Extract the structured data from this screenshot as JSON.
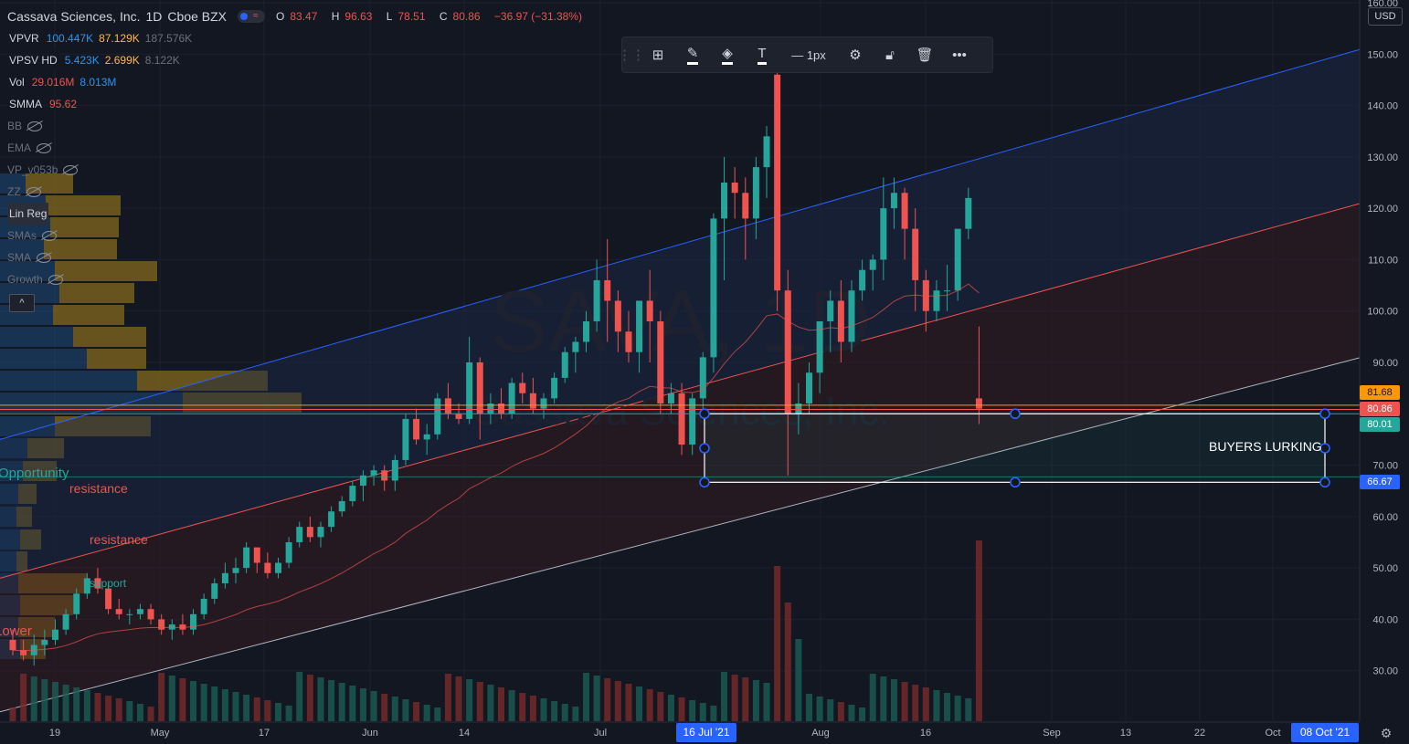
{
  "header": {
    "symbol_name": "Cassava Sciences, Inc.",
    "interval": "1D",
    "exchange": "Cboe BZX",
    "ohlc": {
      "o_label": "O",
      "o": "83.47",
      "h_label": "H",
      "h": "96.63",
      "l_label": "L",
      "l": "78.51",
      "c_label": "C",
      "c": "80.86",
      "change": "−36.97 (−31.38%)"
    }
  },
  "indicators": {
    "vpvr": {
      "name": "VPVR",
      "v1": "100.447K",
      "v2": "87.129K",
      "v3": "187.576K"
    },
    "vpsv": {
      "name": "VPSV HD",
      "v1": "5.423K",
      "v2": "2.699K",
      "v3": "8.122K"
    },
    "vol": {
      "name": "Vol",
      "v1": "29.016M",
      "v2": "8.013M"
    },
    "smma": {
      "name": "SMMA",
      "v1": "95.62"
    },
    "hidden": [
      "BB",
      "EMA",
      "VP_v053b",
      "ZZ"
    ],
    "linreg": "Lin Reg",
    "hidden2": [
      "SMAs",
      "SMA",
      "Growth"
    ],
    "collapse": "^"
  },
  "toolbar": {
    "line_width": "— 1px"
  },
  "watermark": {
    "ticker": "SAVA, 1D",
    "company": "Cassava Sciences, Inc."
  },
  "annotations": {
    "buyers": "BUYERS LURKING",
    "resistance1": "resistance",
    "resistance2": "resistance",
    "support": "support",
    "opportunity": "Opportunity",
    "lower": "Lower"
  },
  "price_axis": {
    "currency": "USD",
    "tick_values": [
      160,
      150,
      140,
      130,
      120,
      110,
      100,
      90,
      70,
      60,
      50,
      40,
      30
    ],
    "tick_labels": [
      "160.00",
      "150.00",
      "140.00",
      "130.00",
      "120.00",
      "110.00",
      "100.00",
      "90.00",
      "70.00",
      "60.00",
      "50.00",
      "40.00",
      "30.00"
    ],
    "tags": [
      {
        "value": 81.68,
        "label": "81.68",
        "color": "#ff9800"
      },
      {
        "value": 80.86,
        "label": "80.86",
        "color": "#ef5350"
      },
      {
        "value": 80.01,
        "label": "80.01",
        "color": "#26a69a"
      },
      {
        "value": 66.67,
        "label": "66.67",
        "color": "#2962ff"
      }
    ]
  },
  "time_axis": {
    "labels": [
      "19",
      "May",
      "17",
      "Jun",
      "14",
      "Jul",
      "Aug",
      "16",
      "Sep",
      "13",
      "22",
      "Oct"
    ],
    "highlight_start": "16 Jul '21",
    "highlight_end": "08 Oct '21"
  },
  "colors": {
    "up": "#26a69a",
    "down": "#ef5350",
    "accent": "#2962ff",
    "bg": "#131722"
  },
  "chart_data": {
    "type": "candlestick",
    "title": "Cassava Sciences, Inc. · 1D · Cboe BZX",
    "ylim": [
      20,
      160
    ],
    "candles": [
      [
        36,
        38,
        33,
        34
      ],
      [
        34,
        36,
        32,
        33
      ],
      [
        33,
        37,
        31,
        35
      ],
      [
        35,
        38,
        33,
        36
      ],
      [
        36,
        40,
        35,
        38
      ],
      [
        38,
        42,
        37,
        41
      ],
      [
        41,
        46,
        40,
        45
      ],
      [
        45,
        49,
        44,
        48
      ],
      [
        48,
        50,
        45,
        46
      ],
      [
        46,
        47,
        41,
        42
      ],
      [
        42,
        44,
        40,
        41
      ],
      [
        41,
        42,
        39,
        41
      ],
      [
        41,
        43,
        40,
        42
      ],
      [
        42,
        43,
        39,
        40
      ],
      [
        40,
        41,
        37,
        38
      ],
      [
        38,
        40,
        36,
        39
      ],
      [
        39,
        41,
        37,
        38
      ],
      [
        38,
        42,
        37,
        41
      ],
      [
        41,
        45,
        40,
        44
      ],
      [
        44,
        48,
        43,
        47
      ],
      [
        47,
        51,
        46,
        49
      ],
      [
        49,
        52,
        47,
        50
      ],
      [
        50,
        55,
        49,
        54
      ],
      [
        54,
        52,
        49,
        51
      ],
      [
        51,
        53,
        48,
        49
      ],
      [
        49,
        52,
        48,
        51
      ],
      [
        51,
        56,
        50,
        55
      ],
      [
        55,
        59,
        54,
        58
      ],
      [
        58,
        60,
        55,
        56
      ],
      [
        56,
        59,
        54,
        58
      ],
      [
        58,
        62,
        57,
        61
      ],
      [
        61,
        64,
        60,
        63
      ],
      [
        63,
        67,
        62,
        66
      ],
      [
        66,
        69,
        63,
        68
      ],
      [
        68,
        70,
        66,
        69
      ],
      [
        69,
        70,
        65,
        67
      ],
      [
        67,
        72,
        65,
        71
      ],
      [
        71,
        80,
        70,
        79
      ],
      [
        79,
        81,
        74,
        75
      ],
      [
        75,
        78,
        72,
        76
      ],
      [
        76,
        84,
        75,
        83
      ],
      [
        83,
        86,
        79,
        80
      ],
      [
        80,
        82,
        78,
        79
      ],
      [
        79,
        95,
        78,
        90
      ],
      [
        90,
        91,
        75,
        80
      ],
      [
        80,
        84,
        78,
        82
      ],
      [
        82,
        85,
        79,
        80
      ],
      [
        80,
        87,
        79,
        86
      ],
      [
        86,
        88,
        82,
        84
      ],
      [
        84,
        87,
        80,
        81
      ],
      [
        81,
        84,
        79,
        83
      ],
      [
        83,
        88,
        82,
        87
      ],
      [
        87,
        93,
        86,
        92
      ],
      [
        92,
        95,
        88,
        94
      ],
      [
        94,
        100,
        92,
        98
      ],
      [
        98,
        110,
        96,
        106
      ],
      [
        106,
        114,
        94,
        102
      ],
      [
        102,
        104,
        92,
        96
      ],
      [
        96,
        100,
        90,
        92
      ],
      [
        92,
        102,
        88,
        102
      ],
      [
        102,
        108,
        90,
        98
      ],
      [
        98,
        100,
        80,
        82
      ],
      [
        82,
        86,
        80,
        84
      ],
      [
        84,
        86,
        72,
        74
      ],
      [
        74,
        84,
        72,
        83
      ],
      [
        83,
        92,
        80,
        91
      ],
      [
        91,
        119,
        88,
        118
      ],
      [
        118,
        130,
        106,
        125
      ],
      [
        125,
        128,
        118,
        123
      ],
      [
        123,
        126,
        110,
        118
      ],
      [
        118,
        130,
        114,
        128
      ],
      [
        128,
        136,
        122,
        134
      ],
      [
        146,
        147,
        100,
        104
      ],
      [
        104,
        108,
        68,
        80
      ],
      [
        80,
        86,
        76,
        82
      ],
      [
        82,
        90,
        80,
        88
      ],
      [
        88,
        98,
        84,
        98
      ],
      [
        98,
        104,
        92,
        102
      ],
      [
        102,
        106,
        90,
        94
      ],
      [
        94,
        106,
        92,
        104
      ],
      [
        104,
        110,
        102,
        108
      ],
      [
        108,
        111,
        104,
        110
      ],
      [
        110,
        126,
        106,
        120
      ],
      [
        120,
        126,
        116,
        123
      ],
      [
        123,
        124,
        110,
        116
      ],
      [
        116,
        120,
        100,
        106
      ],
      [
        106,
        108,
        96,
        100
      ],
      [
        100,
        106,
        98,
        104
      ],
      [
        104,
        109,
        100,
        104
      ],
      [
        104,
        114,
        102,
        116
      ],
      [
        116,
        124,
        114,
        122
      ],
      [
        83,
        97,
        78,
        81
      ]
    ],
    "channel": {
      "upper": [
        [
          0,
          75
        ],
        [
          1490,
          151
        ]
      ],
      "middle": [
        [
          0,
          48
        ],
        [
          1490,
          121
        ]
      ],
      "lower": [
        [
          0,
          22
        ],
        [
          1490,
          91
        ]
      ]
    },
    "rectangle": {
      "top": 80.01,
      "bottom": 66.67,
      "mid": 73.3
    }
  }
}
